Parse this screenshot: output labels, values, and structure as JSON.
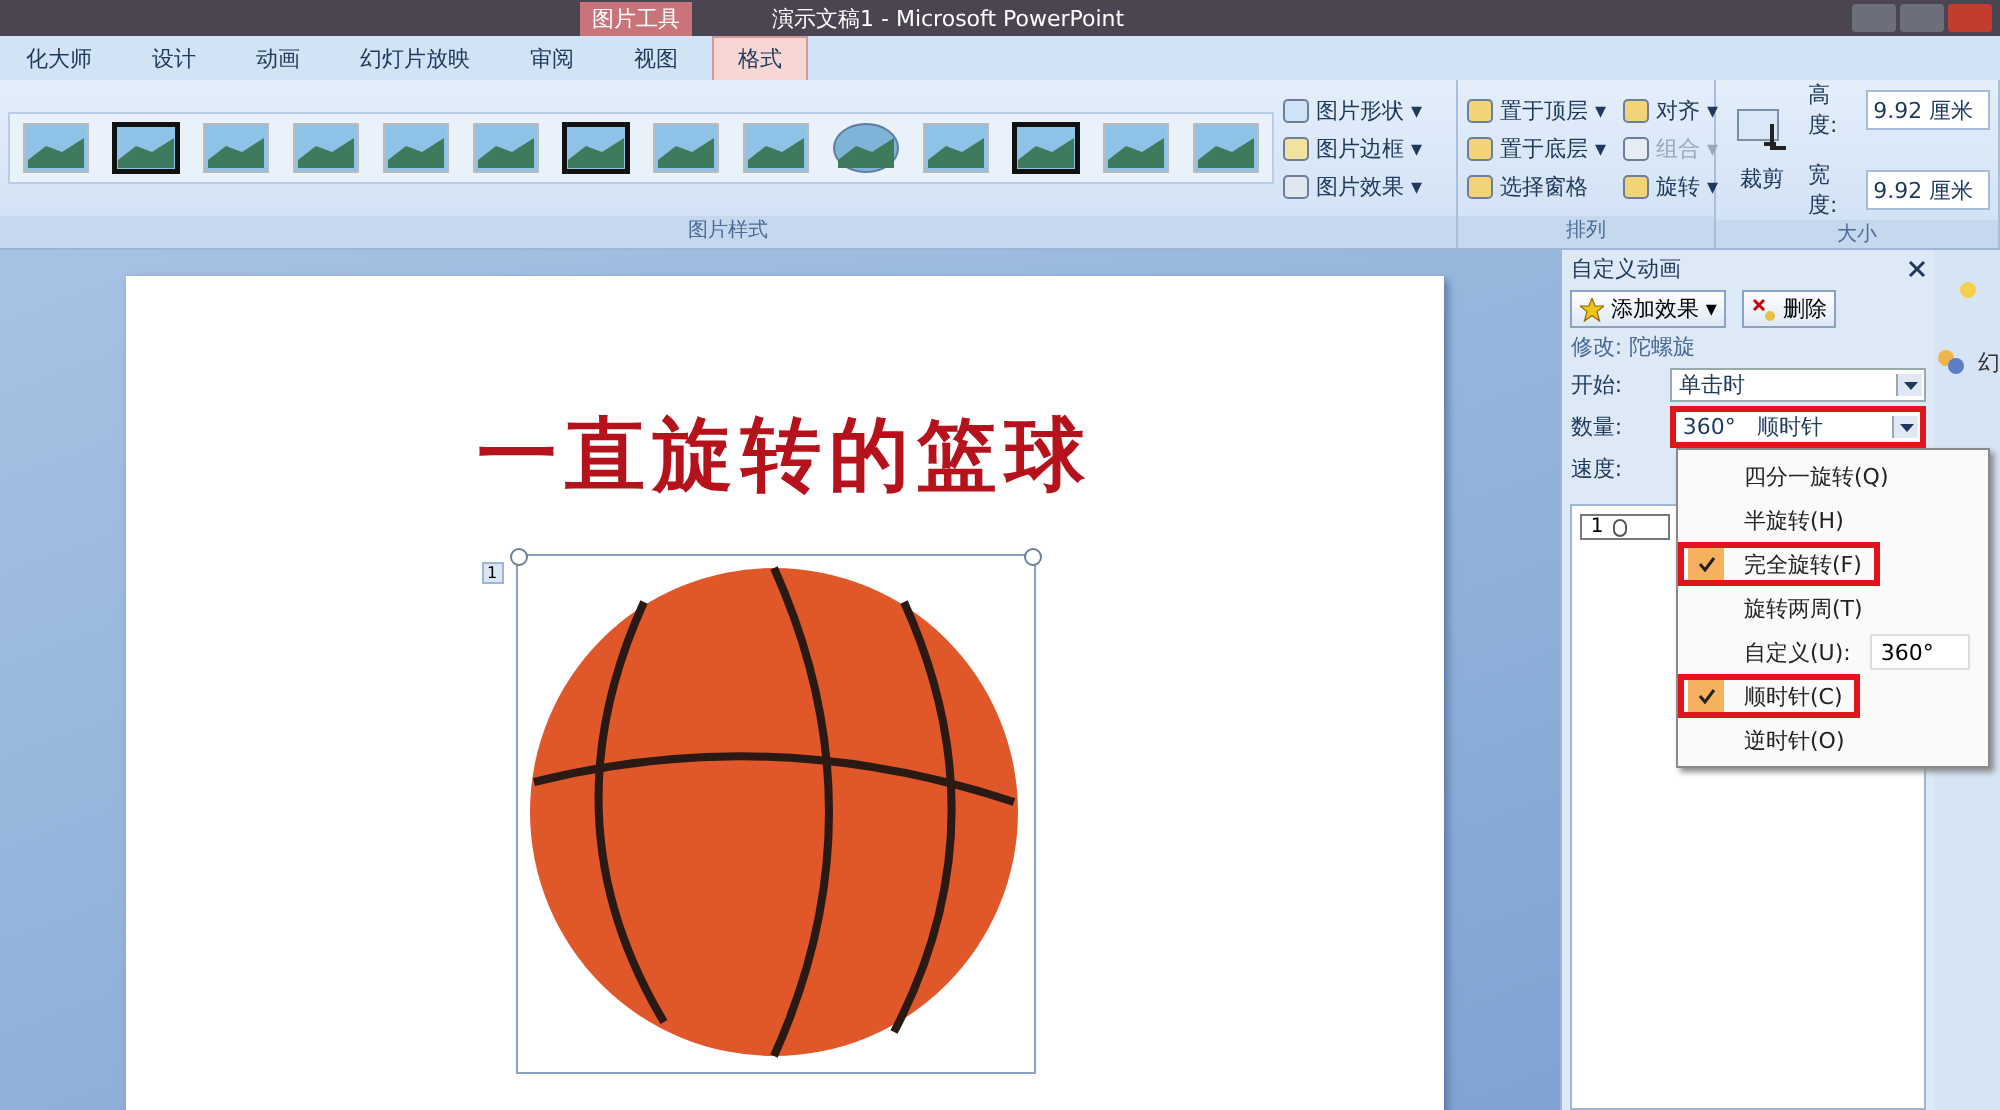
{
  "title_bar": {
    "contextual_tab": "图片工具",
    "title": "演示文稿1 - Microsoft PowerPoint"
  },
  "tabs": [
    {
      "label": "化大师",
      "selected": false
    },
    {
      "label": "设计",
      "selected": false
    },
    {
      "label": "动画",
      "selected": false
    },
    {
      "label": "幻灯片放映",
      "selected": false
    },
    {
      "label": "审阅",
      "selected": false
    },
    {
      "label": "视图",
      "selected": false
    },
    {
      "label": "格式",
      "selected": true
    }
  ],
  "ribbon": {
    "picture_styles": {
      "label": "图片样式",
      "commands": [
        "图片形状 ▾",
        "图片边框 ▾",
        "图片效果 ▾"
      ]
    },
    "arrange": {
      "label": "排列",
      "commands": [
        {
          "label": "置于顶层 ▾",
          "disabled": false
        },
        {
          "label": "对齐 ▾",
          "disabled": false
        },
        {
          "label": "置于底层 ▾",
          "disabled": false
        },
        {
          "label": "组合 ▾",
          "disabled": true
        },
        {
          "label": "选择窗格",
          "disabled": false
        },
        {
          "label": "旋转 ▾",
          "disabled": false
        }
      ]
    },
    "size": {
      "label": "大小",
      "crop": "裁剪",
      "fields": [
        {
          "label": "高度:",
          "value": "9.92 厘米"
        },
        {
          "label": "宽度:",
          "value": "9.92 厘米"
        }
      ]
    }
  },
  "slide": {
    "title": "一直旋转的篮球",
    "animation_tag": "1"
  },
  "task_pane": {
    "title": "自定义动画",
    "add_button": "添加效果 ▾",
    "delete_button": "删除",
    "modify": "修改: 陀螺旋",
    "fields": [
      {
        "label": "开始:",
        "value": "单击时",
        "highlighted": false
      },
      {
        "label": "数量:",
        "value": "360°   顺时针",
        "highlighted": true
      },
      {
        "label": "速度:"
      }
    ],
    "list_item": "1"
  },
  "menu": [
    {
      "kind": "option",
      "label": "四分一旋转(Q)",
      "checked": false,
      "highlighted": false
    },
    {
      "kind": "option",
      "label": "半旋转(H)",
      "checked": false,
      "highlighted": false
    },
    {
      "kind": "option",
      "label": "完全旋转(F)",
      "checked": true,
      "highlighted": true
    },
    {
      "kind": "option",
      "label": "旋转两周(T)",
      "checked": false,
      "highlighted": false
    },
    {
      "kind": "input",
      "label": "自定义(U):",
      "value": "360°"
    },
    {
      "kind": "option",
      "label": "顺时针(C)",
      "checked": true,
      "highlighted": true
    },
    {
      "kind": "option",
      "label": "逆时针(O)",
      "checked": false,
      "highlighted": false
    }
  ],
  "side_strip": {
    "label": "幻"
  }
}
